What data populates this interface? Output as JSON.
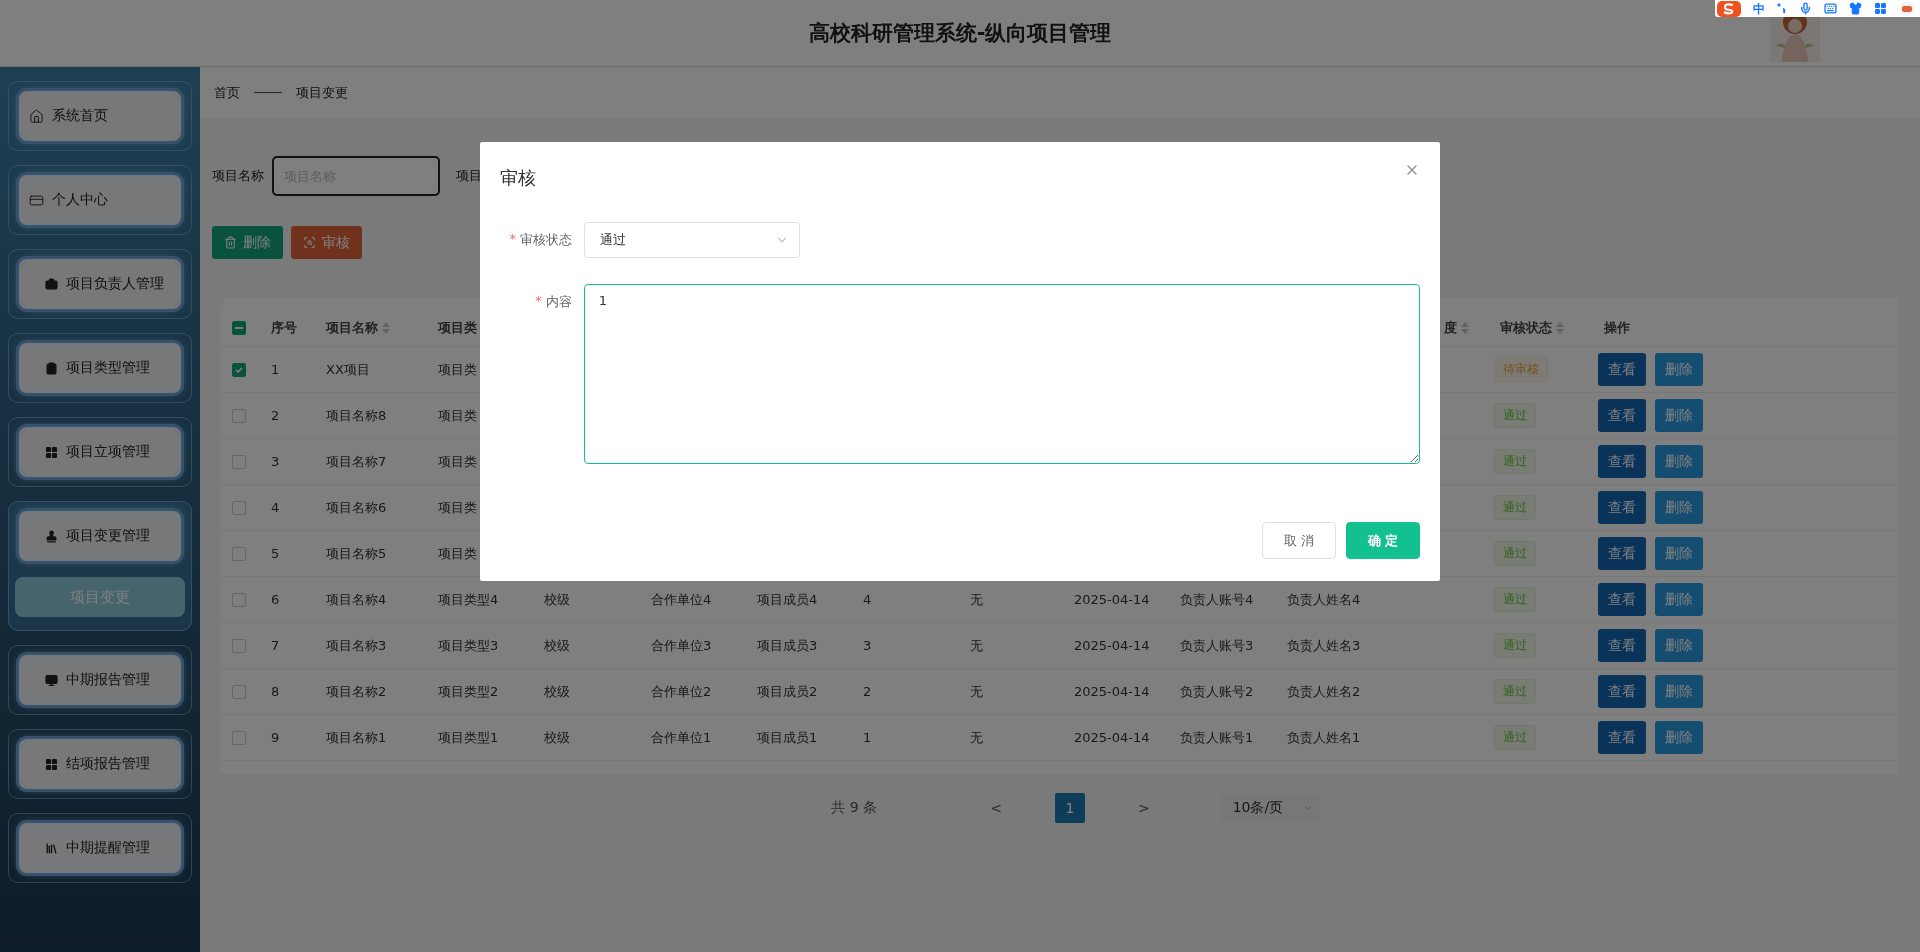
{
  "header": {
    "title": "高校科研管理系统-纵向项目管理"
  },
  "ime_toolbar": {
    "mode": "中"
  },
  "sidebar": {
    "items": [
      {
        "label": "系统首页"
      },
      {
        "label": "个人中心"
      },
      {
        "label": "项目负责人管理"
      },
      {
        "label": "项目类型管理"
      },
      {
        "label": "项目立项管理"
      },
      {
        "label": "项目变更管理",
        "expanded": true,
        "children": [
          {
            "label": "项目变更",
            "selected": true
          }
        ]
      },
      {
        "label": "中期报告管理"
      },
      {
        "label": "结项报告管理"
      },
      {
        "label": "中期提醒管理"
      }
    ]
  },
  "breadcrumb": [
    "首页",
    "项目变更"
  ],
  "search": {
    "label": "项目名称",
    "placeholder": "项目名称",
    "next_label": "项目"
  },
  "toolbar": [
    {
      "kind": "delete",
      "label": "删除"
    },
    {
      "kind": "audit",
      "label": "审核"
    }
  ],
  "table": {
    "header_checkbox": {
      "indeterminate": true
    },
    "columns": [
      {
        "label": "序号",
        "sortable": false
      },
      {
        "label": "项目名称",
        "sortable": true
      },
      {
        "label": "项目类"
      },
      {
        "label": "度",
        "sortable": true
      },
      {
        "label": "审核状态",
        "sortable": true
      },
      {
        "label": "操作",
        "sortable": false
      }
    ],
    "rows": [
      {
        "checked": true,
        "index": "1",
        "name": "XX项目",
        "type": "项目类",
        "status": "待审核",
        "approved": false,
        "actions": [
          "查看",
          "删除"
        ]
      },
      {
        "checked": false,
        "index": "2",
        "name": "项目名称8",
        "type": "项目类",
        "status": "通过",
        "approved": true,
        "actions": [
          "查看",
          "删除"
        ]
      },
      {
        "checked": false,
        "index": "3",
        "name": "项目名称7",
        "type": "项目类",
        "status": "通过",
        "approved": true,
        "actions": [
          "查看",
          "删除"
        ]
      },
      {
        "checked": false,
        "index": "4",
        "name": "项目名称6",
        "type": "项目类",
        "status": "通过",
        "approved": true,
        "actions": [
          "查看",
          "删除"
        ]
      },
      {
        "checked": false,
        "index": "5",
        "name": "项目名称5",
        "type": "项目类",
        "status": "通过",
        "approved": true,
        "actions": [
          "查看",
          "删除"
        ]
      },
      {
        "checked": false,
        "index": "6",
        "name": "项目名称4",
        "type": "项目类型4",
        "level": "校级",
        "partner": "合作单位4",
        "members": "项目成员4",
        "count": "4",
        "note": "无",
        "date": "2025-04-14",
        "account": "负责人账号4",
        "leader": "负责人姓名4",
        "status": "通过",
        "approved": true,
        "actions": [
          "查看",
          "删除"
        ]
      },
      {
        "checked": false,
        "index": "7",
        "name": "项目名称3",
        "type": "项目类型3",
        "level": "校级",
        "partner": "合作单位3",
        "members": "项目成员3",
        "count": "3",
        "note": "无",
        "date": "2025-04-14",
        "account": "负责人账号3",
        "leader": "负责人姓名3",
        "status": "通过",
        "approved": true,
        "actions": [
          "查看",
          "删除"
        ]
      },
      {
        "checked": false,
        "index": "8",
        "name": "项目名称2",
        "type": "项目类型2",
        "level": "校级",
        "partner": "合作单位2",
        "members": "项目成员2",
        "count": "2",
        "note": "无",
        "date": "2025-04-14",
        "account": "负责人账号2",
        "leader": "负责人姓名2",
        "status": "通过",
        "approved": true,
        "actions": [
          "查看",
          "删除"
        ]
      },
      {
        "checked": false,
        "index": "9",
        "name": "项目名称1",
        "type": "项目类型1",
        "level": "校级",
        "partner": "合作单位1",
        "members": "项目成员1",
        "count": "1",
        "note": "无",
        "date": "2025-04-14",
        "account": "负责人账号1",
        "leader": "负责人姓名1",
        "status": "通过",
        "approved": true,
        "actions": [
          "查看",
          "删除"
        ]
      }
    ]
  },
  "pagination": {
    "total": "共 9 条",
    "prev": "<",
    "pages": [
      {
        "label": "1",
        "selected": true
      }
    ],
    "next": ">",
    "page_size": "10条/页"
  },
  "dialog": {
    "title": "审核",
    "fields": [
      {
        "kind": "select",
        "marker": "*",
        "label": "审核状态",
        "value": "通过"
      },
      {
        "kind": "textarea",
        "marker": "*",
        "label": "内容",
        "value": "1"
      }
    ],
    "buttons": [
      {
        "kind": "cancel",
        "label": "取 消"
      },
      {
        "kind": "confirm",
        "label": "确 定"
      }
    ]
  }
}
